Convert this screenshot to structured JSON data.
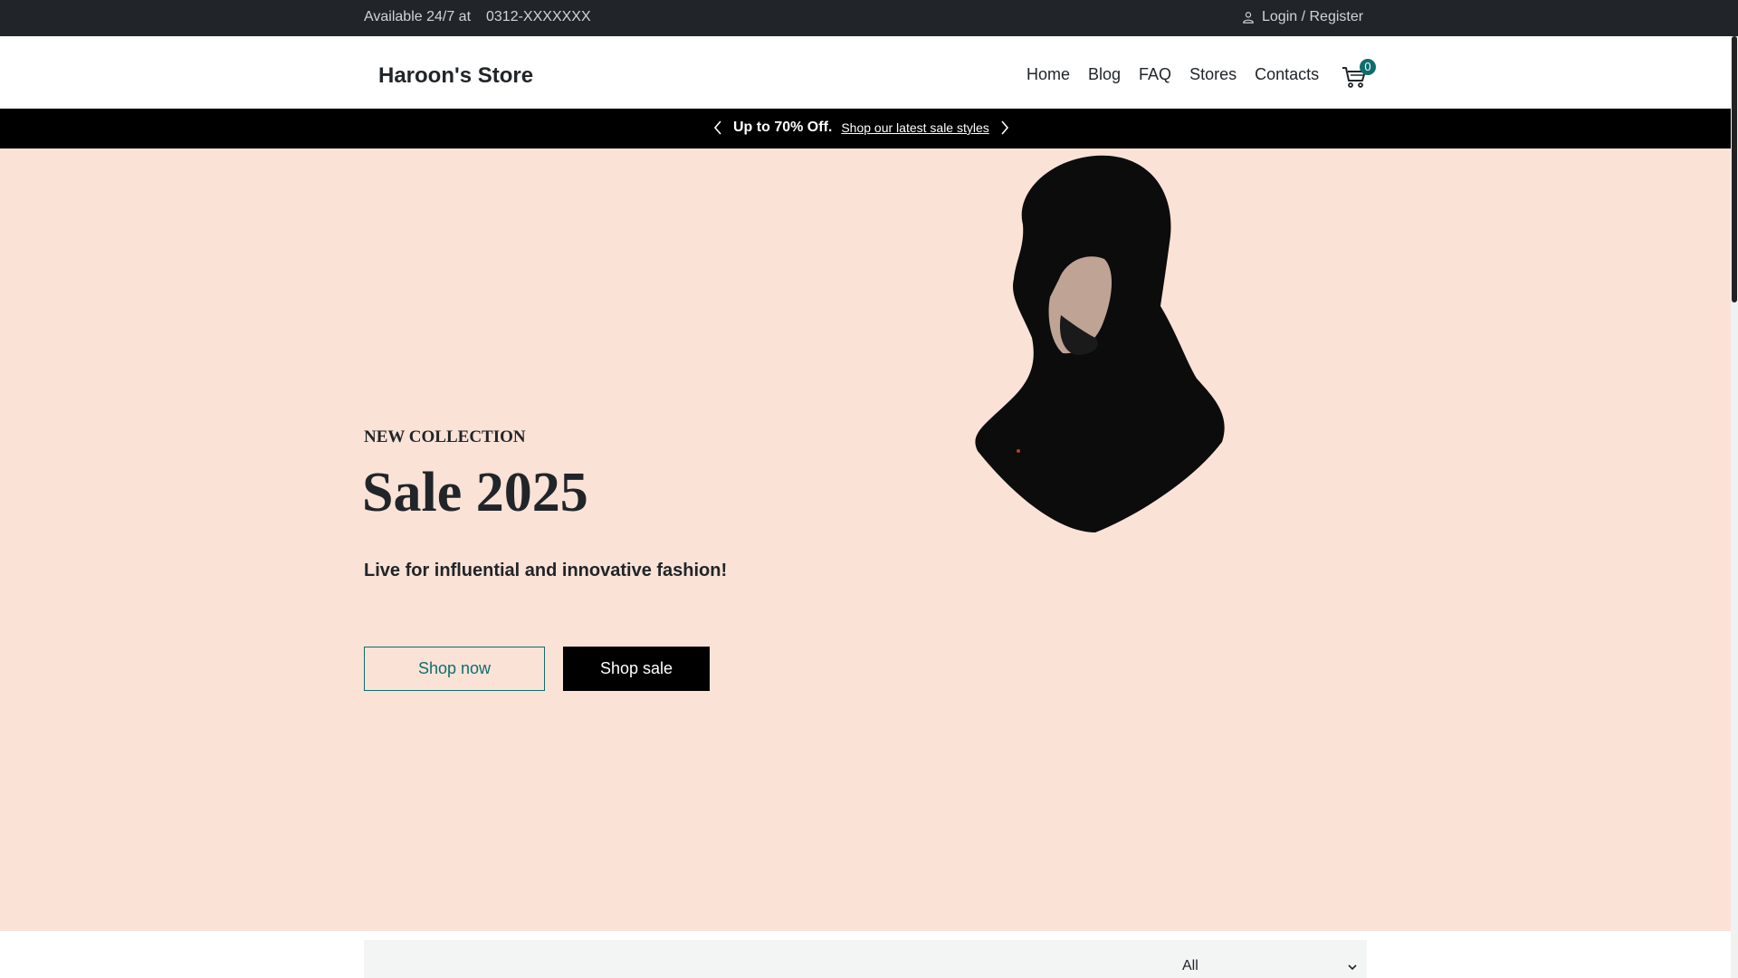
{
  "topbar": {
    "availability": "Available 24/7 at",
    "phone": "0312-XXXXXXX",
    "login_label": "Login / Register",
    "login_icon": "user-icon"
  },
  "header": {
    "brand": "Haroon's Store",
    "nav": [
      "Home",
      "Blog",
      "FAQ",
      "Stores",
      "Contacts"
    ],
    "cart_count": "0",
    "cart_icon": "cart-icon"
  },
  "promo": {
    "headline": "Up to 70% Off.",
    "link": "Shop our latest sale styles",
    "prev_icon": "chevron-left-icon",
    "next_icon": "chevron-right-icon"
  },
  "hero": {
    "eyebrow": "NEW COLLECTION",
    "title": "Sale 2025",
    "tagline": "Live for influential and innovative fashion!",
    "shop_now": "Shop now",
    "shop_sale": "Shop sale",
    "background_color": "#fae2d7"
  },
  "filter": {
    "selected": "All",
    "dropdown_icon": "chevron-down-icon"
  },
  "colors": {
    "topbar": "#212529",
    "accent": "#0e6e6b",
    "promo": "#000000"
  }
}
